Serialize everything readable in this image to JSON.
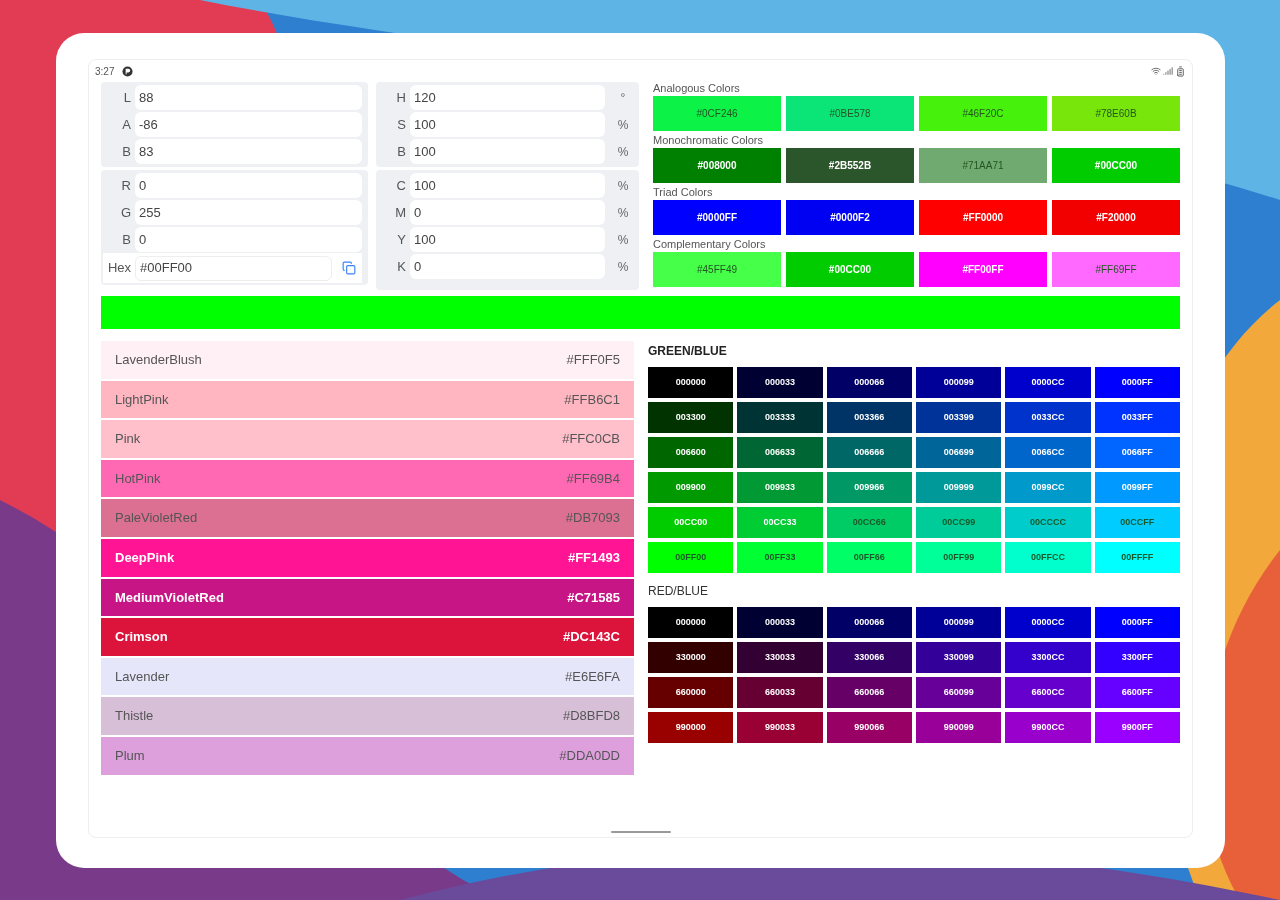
{
  "status_bar": {
    "time": "3:27"
  },
  "lab_fields": [
    {
      "label": "L",
      "value": "88"
    },
    {
      "label": "A",
      "value": "-86"
    },
    {
      "label": "B",
      "value": "83"
    }
  ],
  "rgb_fields": [
    {
      "label": "R",
      "value": "0"
    },
    {
      "label": "G",
      "value": "255"
    },
    {
      "label": "B",
      "value": "0"
    }
  ],
  "hex_field": {
    "label": "Hex",
    "value": "#00FF00"
  },
  "hsb_fields": [
    {
      "label": "H",
      "value": "120",
      "unit": "°"
    },
    {
      "label": "S",
      "value": "100",
      "unit": "%"
    },
    {
      "label": "B",
      "value": "100",
      "unit": "%"
    }
  ],
  "cmyk_fields": [
    {
      "label": "C",
      "value": "100",
      "unit": "%"
    },
    {
      "label": "M",
      "value": "0",
      "unit": "%"
    },
    {
      "label": "Y",
      "value": "100",
      "unit": "%"
    },
    {
      "label": "K",
      "value": "0",
      "unit": "%"
    }
  ],
  "schemes": [
    {
      "title": "Analogous Colors",
      "swatches": [
        {
          "label": "#0CF246",
          "color": "#0cf246"
        },
        {
          "label": "#0BE578",
          "color": "#0be578"
        },
        {
          "label": "#46F20C",
          "color": "#46f20c"
        },
        {
          "label": "#78E60B",
          "color": "#78e60b"
        }
      ]
    },
    {
      "title": "Monochromatic Colors",
      "swatches": [
        {
          "label": "#008000",
          "color": "#008000"
        },
        {
          "label": "#2B552B",
          "color": "#2b552b"
        },
        {
          "label": "#71AA71",
          "color": "#71aa71"
        },
        {
          "label": "#00CC00",
          "color": "#00cc00"
        }
      ]
    },
    {
      "title": "Triad Colors",
      "swatches": [
        {
          "label": "#0000FF",
          "color": "#0000ff"
        },
        {
          "label": "#0000F2",
          "color": "#0000f2"
        },
        {
          "label": "#FF0000",
          "color": "#ff0000"
        },
        {
          "label": "#F20000",
          "color": "#f20000"
        }
      ]
    },
    {
      "title": "Complementary Colors",
      "swatches": [
        {
          "label": "#45FF49",
          "color": "#45ff49"
        },
        {
          "label": "#00CC00",
          "color": "#00cc00"
        },
        {
          "label": "#FF00FF",
          "color": "#ff00ff"
        },
        {
          "label": "#FF69FF",
          "color": "#ff69ff"
        }
      ]
    }
  ],
  "current_color": {
    "color": "#00ff00"
  },
  "named_colors": [
    {
      "name": "LavenderBlush",
      "hex": "#FFF0F5",
      "color": "#fff0f5"
    },
    {
      "name": "LightPink",
      "hex": "#FFB6C1",
      "color": "#ffb6c1"
    },
    {
      "name": "Pink",
      "hex": "#FFC0CB",
      "color": "#ffc0cb"
    },
    {
      "name": "HotPink",
      "hex": "#FF69B4",
      "color": "#ff69b4"
    },
    {
      "name": "PaleVioletRed",
      "hex": "#DB7093",
      "color": "#db7093"
    },
    {
      "name": "DeepPink",
      "hex": "#FF1493",
      "color": "#ff1493"
    },
    {
      "name": "MediumVioletRed",
      "hex": "#C71585",
      "color": "#c71585"
    },
    {
      "name": "Crimson",
      "hex": "#DC143C",
      "color": "#dc143c"
    },
    {
      "name": "Lavender",
      "hex": "#E6E6FA",
      "color": "#e6e6fa"
    },
    {
      "name": "Thistle",
      "hex": "#D8BFD8",
      "color": "#d8bfd8"
    },
    {
      "name": "Plum",
      "hex": "#DDA0DD",
      "color": "#dda0dd"
    }
  ],
  "grids": [
    {
      "title": "GREEN/BLUE",
      "rows": [
        [
          {
            "label": "000000",
            "color": "#000000"
          },
          {
            "label": "000033",
            "color": "#000033"
          },
          {
            "label": "000066",
            "color": "#000066"
          },
          {
            "label": "000099",
            "color": "#000099"
          },
          {
            "label": "0000CC",
            "color": "#0000cc"
          },
          {
            "label": "0000FF",
            "color": "#0000ff"
          }
        ],
        [
          {
            "label": "003300",
            "color": "#003300"
          },
          {
            "label": "003333",
            "color": "#003333"
          },
          {
            "label": "003366",
            "color": "#003366"
          },
          {
            "label": "003399",
            "color": "#003399"
          },
          {
            "label": "0033CC",
            "color": "#0033cc"
          },
          {
            "label": "0033FF",
            "color": "#0033ff"
          }
        ],
        [
          {
            "label": "006600",
            "color": "#006600"
          },
          {
            "label": "006633",
            "color": "#006633"
          },
          {
            "label": "006666",
            "color": "#006666"
          },
          {
            "label": "006699",
            "color": "#006699"
          },
          {
            "label": "0066CC",
            "color": "#0066cc"
          },
          {
            "label": "0066FF",
            "color": "#0066ff"
          }
        ],
        [
          {
            "label": "009900",
            "color": "#009900"
          },
          {
            "label": "009933",
            "color": "#009933"
          },
          {
            "label": "009966",
            "color": "#009966"
          },
          {
            "label": "009999",
            "color": "#009999"
          },
          {
            "label": "0099CC",
            "color": "#0099cc"
          },
          {
            "label": "0099FF",
            "color": "#0099ff"
          }
        ],
        [
          {
            "label": "00CC00",
            "color": "#00cc00"
          },
          {
            "label": "00CC33",
            "color": "#00cc33"
          },
          {
            "label": "00CC66",
            "color": "#00cc66"
          },
          {
            "label": "00CC99",
            "color": "#00cc99"
          },
          {
            "label": "00CCCC",
            "color": "#00cccc"
          },
          {
            "label": "00CCFF",
            "color": "#00ccff"
          }
        ],
        [
          {
            "label": "00FF00",
            "color": "#00ff00"
          },
          {
            "label": "00FF33",
            "color": "#00ff33"
          },
          {
            "label": "00FF66",
            "color": "#00ff66"
          },
          {
            "label": "00FF99",
            "color": "#00ff99"
          },
          {
            "label": "00FFCC",
            "color": "#00ffcc"
          },
          {
            "label": "00FFFF",
            "color": "#00ffff"
          }
        ]
      ]
    },
    {
      "title": "RED/BLUE",
      "rows": [
        [
          {
            "label": "000000",
            "color": "#000000"
          },
          {
            "label": "000033",
            "color": "#000033"
          },
          {
            "label": "000066",
            "color": "#000066"
          },
          {
            "label": "000099",
            "color": "#000099"
          },
          {
            "label": "0000CC",
            "color": "#0000cc"
          },
          {
            "label": "0000FF",
            "color": "#0000ff"
          }
        ],
        [
          {
            "label": "330000",
            "color": "#330000"
          },
          {
            "label": "330033",
            "color": "#330033"
          },
          {
            "label": "330066",
            "color": "#330066"
          },
          {
            "label": "330099",
            "color": "#330099"
          },
          {
            "label": "3300CC",
            "color": "#3300cc"
          },
          {
            "label": "3300FF",
            "color": "#3300ff"
          }
        ],
        [
          {
            "label": "660000",
            "color": "#660000"
          },
          {
            "label": "660033",
            "color": "#660033"
          },
          {
            "label": "660066",
            "color": "#660066"
          },
          {
            "label": "660099",
            "color": "#660099"
          },
          {
            "label": "6600CC",
            "color": "#6600cc"
          },
          {
            "label": "6600FF",
            "color": "#6600ff"
          }
        ],
        [
          {
            "label": "990000",
            "color": "#990000"
          },
          {
            "label": "990033",
            "color": "#990033"
          },
          {
            "label": "990066",
            "color": "#990066"
          },
          {
            "label": "990099",
            "color": "#990099"
          },
          {
            "label": "9900CC",
            "color": "#9900cc"
          },
          {
            "label": "9900FF",
            "color": "#9900ff"
          }
        ]
      ]
    }
  ]
}
